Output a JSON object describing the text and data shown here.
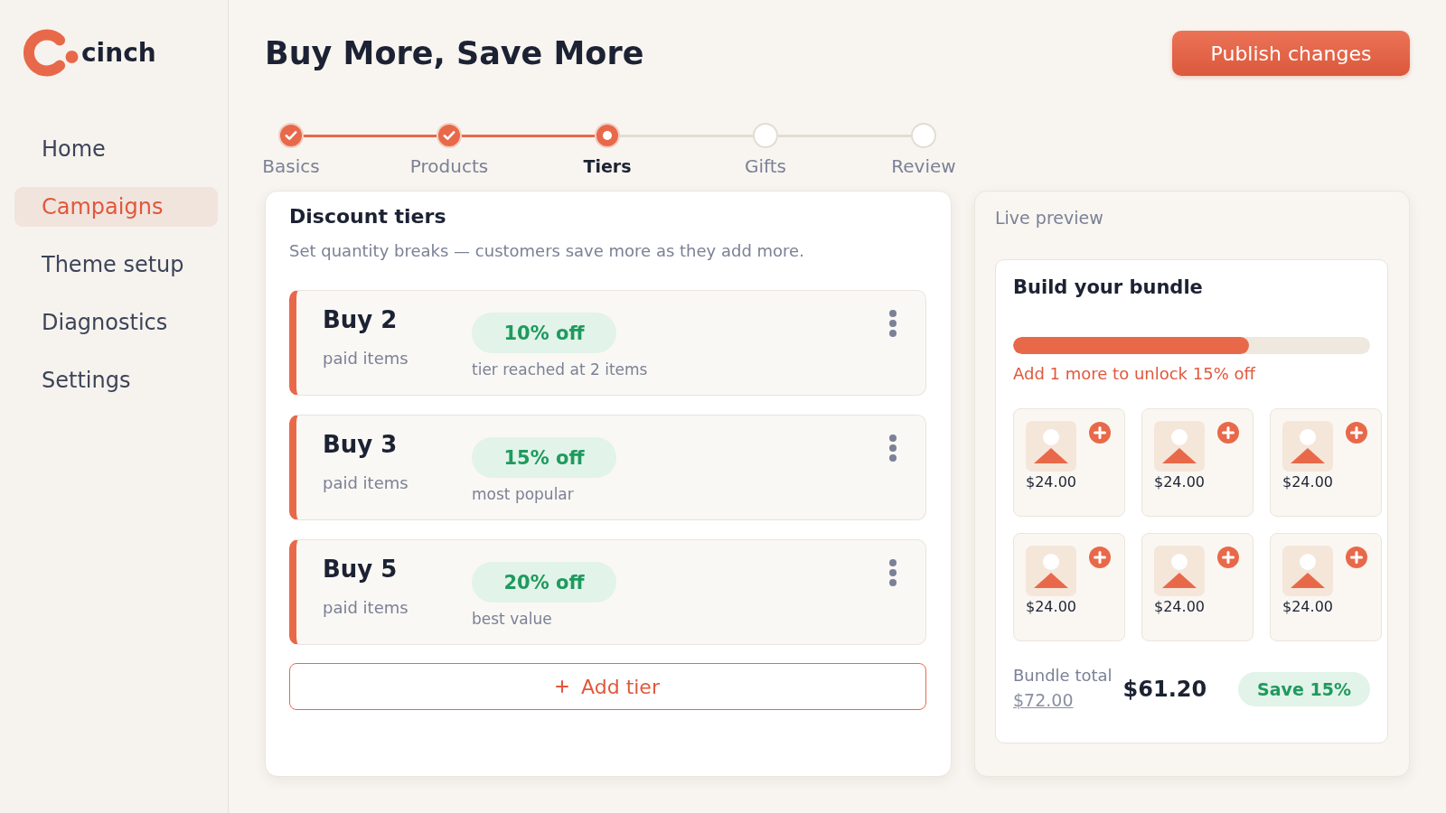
{
  "sidebar": {
    "logo": {
      "text": "cinch"
    },
    "items": [
      {
        "label": "Home",
        "selected": false
      },
      {
        "label": "Campaigns",
        "selected": true
      },
      {
        "label": "Theme setup",
        "selected": false
      },
      {
        "label": "Diagnostics",
        "selected": false
      },
      {
        "label": "Settings",
        "selected": false
      }
    ]
  },
  "header": {
    "title": "Buy More, Save More",
    "publish_button": {
      "label": "Publish changes"
    }
  },
  "stepper": {
    "steps": [
      {
        "label": "Basics",
        "completed": true,
        "selected": false
      },
      {
        "label": "Products",
        "completed": true,
        "selected": false
      },
      {
        "label": "Tiers",
        "completed": false,
        "selected": true
      },
      {
        "label": "Gifts",
        "completed": false,
        "selected": false
      },
      {
        "label": "Review",
        "completed": false,
        "selected": false
      }
    ]
  },
  "discount_tiers": {
    "title": "Discount tiers",
    "subtitle": "Set quantity breaks — customers save more as they add more.",
    "tiers": [
      {
        "quantity": "Buy 2",
        "unit": "paid items",
        "discount": "10% off",
        "note": "tier reached at 2 items"
      },
      {
        "quantity": "Buy 3",
        "unit": "paid items",
        "discount": "15% off",
        "note": "most popular"
      },
      {
        "quantity": "Buy 5",
        "unit": "paid items",
        "discount": "20% off",
        "note": "best value"
      }
    ],
    "add_button": {
      "label": "Add tier"
    }
  },
  "live_preview": {
    "title": "Live preview",
    "bundle": {
      "title": "Build your bundle",
      "progress": {
        "level": 0.66
      },
      "hint": "Add 1 more to unlock 15% off",
      "products": [
        {
          "price": "$24.00"
        },
        {
          "price": "$24.00"
        },
        {
          "price": "$24.00"
        },
        {
          "price": "$24.00"
        },
        {
          "price": "$24.00"
        },
        {
          "price": "$24.00"
        }
      ],
      "total_label": "Bundle total",
      "original_price": "$72.00",
      "total_price": "$61.20",
      "savings": "Save 15%"
    }
  }
}
